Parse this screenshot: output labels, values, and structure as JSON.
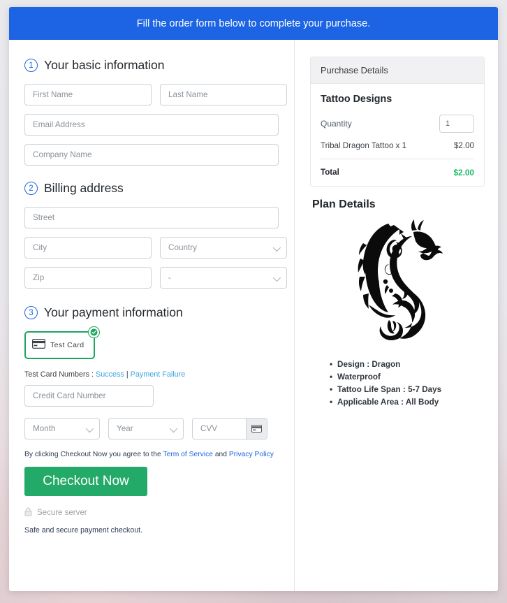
{
  "banner": {
    "text": "Fill the order form below to complete your purchase."
  },
  "steps": {
    "one": {
      "num": "1",
      "title": "Your basic information"
    },
    "two": {
      "num": "2",
      "title": "Billing address"
    },
    "three": {
      "num": "3",
      "title": "Your payment information"
    }
  },
  "basic": {
    "first_name_placeholder": "First Name",
    "last_name_placeholder": "Last Name",
    "email_placeholder": "Email Address",
    "company_placeholder": "Company Name"
  },
  "billing": {
    "street_placeholder": "Street",
    "city_placeholder": "City",
    "country_placeholder": "Country",
    "zip_placeholder": "Zip",
    "state_placeholder": "-"
  },
  "payment": {
    "method_label": "Test  Card",
    "test_prefix": "Test Card Numbers : ",
    "link_success": "Success",
    "separator": " | ",
    "link_failure": "Payment Failure",
    "card_number_placeholder": "Credit Card Number",
    "month_placeholder": "Month",
    "year_placeholder": "Year",
    "cvv_placeholder": "CVV"
  },
  "terms": {
    "prefix": "By clicking Checkout Now you agree to the ",
    "tos": "Term of Service",
    "middle": " and ",
    "privacy": "Privacy Policy"
  },
  "actions": {
    "checkout_label": "Checkout Now",
    "secure_server": "Secure server",
    "safe_note": "Safe and secure payment checkout."
  },
  "purchase": {
    "header": "Purchase Details",
    "product": "Tattoo Designs",
    "quantity_label": "Quantity",
    "quantity_value": "1",
    "line_item": "Tribal Dragon Tattoo x 1",
    "line_price": "$2.00",
    "total_label": "Total",
    "total_price": "$2.00"
  },
  "plan": {
    "title": "Plan Details",
    "features": [
      "Design : Dragon",
      "Waterproof",
      "Tattoo Life Span : 5-7 Days",
      "Applicable Area : All Body"
    ]
  },
  "colors": {
    "banner_blue": "#1c64e3",
    "accent_blue": "#1c64e3",
    "success_green": "#23a968",
    "total_green": "#1bb96a",
    "tile_green": "#1ea65f",
    "link_blue": "#3ba3e0"
  }
}
